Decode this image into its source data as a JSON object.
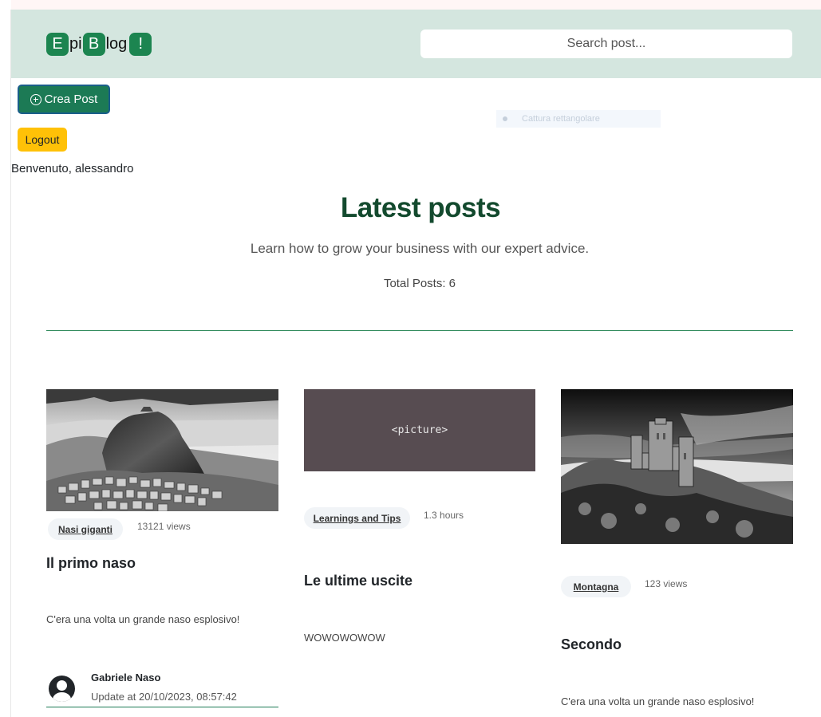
{
  "navbar": {
    "logo": [
      {
        "text": "E",
        "boxed": true
      },
      {
        "text": "pi",
        "boxed": false
      },
      {
        "text": "B",
        "boxed": true
      },
      {
        "text": "log",
        "boxed": false
      },
      {
        "text": "!",
        "boxed": true
      }
    ],
    "search_placeholder": "Search post..."
  },
  "actions": {
    "crea_post_label": "Crea Post",
    "logout_label": "Logout"
  },
  "overlay": {
    "capture_label": "Cattura rettangolare"
  },
  "welcome": "Benvenuto, alessandro",
  "header": {
    "title": "Latest posts",
    "subtitle": "Learn how to grow your business with our expert advice.",
    "total": "Total Posts: 6"
  },
  "posts": [
    {
      "image": "black-and-white-mountain-village",
      "tag": "Nasi giganti",
      "views": "13121 views",
      "title": "Il primo naso",
      "description": "C'era una volta un grande naso esplosivo!",
      "author": "Gabriele Naso",
      "updated": "Update at 20/10/2023, 08:57:42"
    },
    {
      "image_placeholder": "<picture>",
      "tag": "Learnings and Tips",
      "views": "1.3 hours",
      "title": "Le ultime uscite",
      "description": "WOWOWOWOW"
    },
    {
      "image": "black-and-white-castle-ruins",
      "tag": "Montagna",
      "views": "123 views",
      "title": "Secondo",
      "description": "C'era una volta un grande naso esplosivo!"
    }
  ],
  "colors": {
    "navbar_bg": "#d4e6df",
    "brand_green": "#1c8550",
    "title_green": "#134a2e",
    "logout_yellow": "#ffc107",
    "placeholder_bg": "#574c51"
  }
}
